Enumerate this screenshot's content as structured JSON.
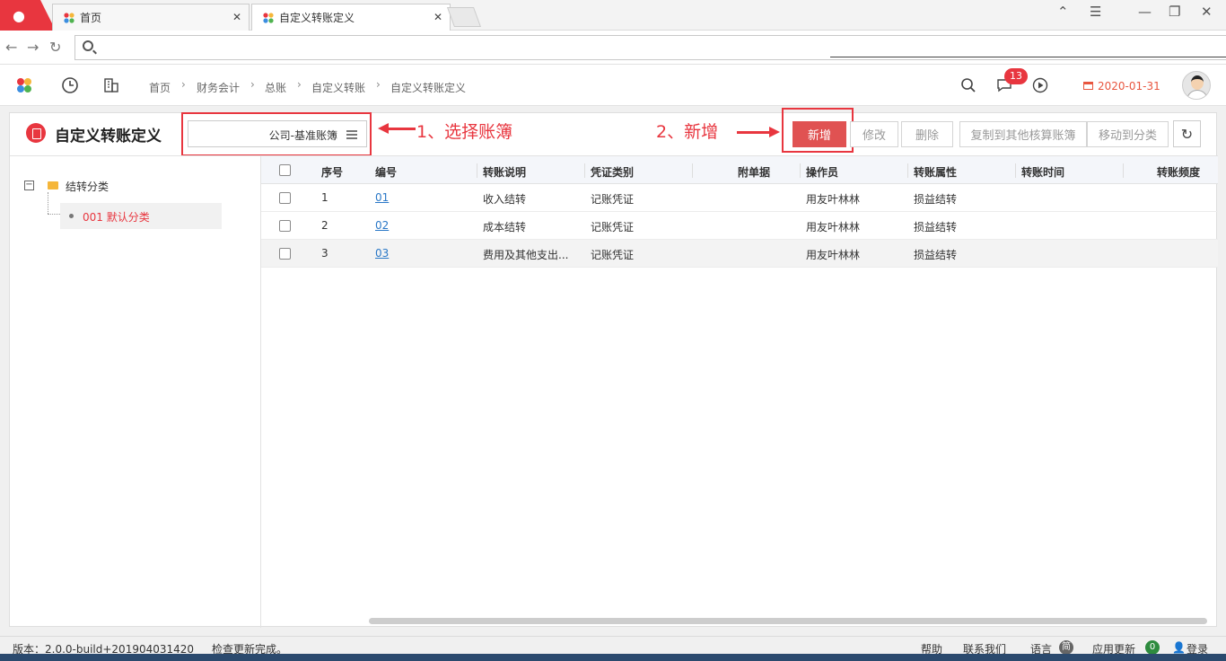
{
  "browser": {
    "tabs": [
      {
        "label": "首页"
      },
      {
        "label": "自定义转账定义"
      }
    ],
    "close_glyph": "✕"
  },
  "breadcrumb": [
    "首页",
    "财务会计",
    "总账",
    "自定义转账",
    "自定义转账定义"
  ],
  "header": {
    "message_count": "13",
    "date": "2020-01-31"
  },
  "page": {
    "title": "自定义转账定义",
    "book_select_value": "公司-基准账簿",
    "annotation_1": "1、选择账簿",
    "annotation_2": "2、新增"
  },
  "toolbar": {
    "add": "新增",
    "edit": "修改",
    "delete": "删除",
    "copy": "复制到其他核算账簿",
    "move": "移动到分类"
  },
  "tree": {
    "root": "结转分类",
    "child": "001 默认分类"
  },
  "grid": {
    "columns": [
      "序号",
      "编号",
      "转账说明",
      "凭证类别",
      "附单据",
      "操作员",
      "转账属性",
      "转账时间",
      "转账频度"
    ],
    "rows": [
      {
        "seq": "1",
        "code": "01",
        "desc": "收入结转",
        "voucher": "记账凭证",
        "operator": "用友叶林林",
        "attr": "损益结转"
      },
      {
        "seq": "2",
        "code": "02",
        "desc": "成本结转",
        "voucher": "记账凭证",
        "operator": "用友叶林林",
        "attr": "损益结转"
      },
      {
        "seq": "3",
        "code": "03",
        "desc": "费用及其他支出...",
        "voucher": "记账凭证",
        "operator": "用友叶林林",
        "attr": "损益结转"
      }
    ]
  },
  "status": {
    "version": "版本：2.0.0-build+201904031420",
    "update_msg": "检查更新完成。",
    "help": "帮助",
    "contact": "联系我们",
    "language": "语言",
    "lang_badge": "简",
    "app_update": "应用更新",
    "update_count": "0",
    "login": "登录"
  },
  "colors": {
    "brand": "#e8363f",
    "link": "#2a78c7",
    "date": "#e8563f"
  }
}
